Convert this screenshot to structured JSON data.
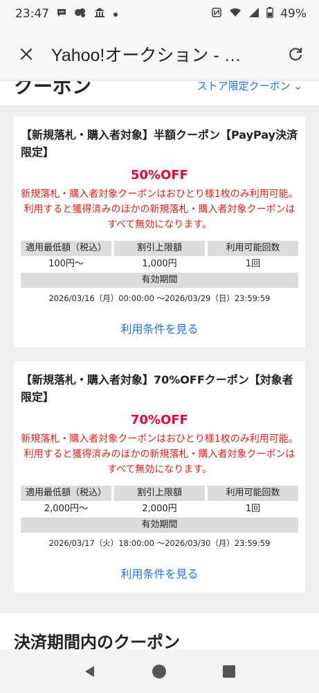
{
  "status_bar": {
    "time": "23:47",
    "battery": "49%"
  },
  "header": {
    "title": "Yahoo!オークション - …"
  },
  "section_top": {
    "title": "クーポン",
    "link": "ストア限定クーポン"
  },
  "coupons": [
    {
      "title": "【新規落札・購入者対象】半額クーポン【PayPay決済限定】",
      "discount": "50%OFF",
      "notice": "新規落札・購入者対象クーポンはおひとり様1枚のみ利用可能。利用すると獲得済みのほかの新規落札・購入者対象クーポンはすべて無効になります。",
      "headers": [
        "適用最低額（税込）",
        "割引上限額",
        "利用可能回数"
      ],
      "values": [
        "100円〜",
        "1,000円",
        "1回"
      ],
      "period_label": "有効期間",
      "period": "2026/03/16（月）00:00:00 〜2026/03/29（日）23:59:59",
      "link": "利用条件を見る"
    },
    {
      "title": "【新規落札・購入者対象】70%OFFクーポン【対象者限定】",
      "discount": "70%OFF",
      "notice": "新規落札・購入者対象クーポンはおひとり様1枚のみ利用可能。利用すると獲得済みのほかの新規落札・購入者対象クーポンはすべて無効になります。",
      "headers": [
        "適用最低額（税込）",
        "割引上限額",
        "利用可能回数"
      ],
      "values": [
        "2,000円〜",
        "2,000円",
        "1回"
      ],
      "period_label": "有効期間",
      "period": "2026/03/17（火）18:00:00 〜2026/03/30（月）23:59:59",
      "link": "利用条件を見る"
    }
  ],
  "section_next": {
    "title": "決済期間内のクーポン"
  },
  "colors": {
    "discount": "#e60033",
    "notice": "#e02020",
    "link": "#1a73e8"
  }
}
